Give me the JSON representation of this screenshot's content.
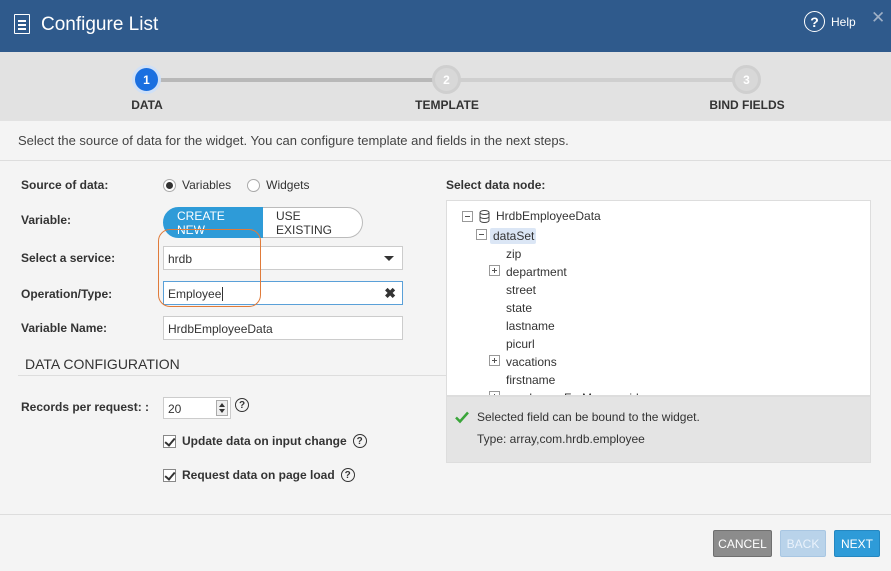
{
  "header": {
    "title": "Configure List",
    "help_label": "Help",
    "close_glyph": "✕"
  },
  "stepper": {
    "steps": [
      {
        "number": "1",
        "label": "DATA",
        "active": true
      },
      {
        "number": "2",
        "label": "TEMPLATE",
        "active": false
      },
      {
        "number": "3",
        "label": "BIND FIELDS",
        "active": false
      }
    ]
  },
  "intro": "Select the source of data for the widget. You can configure template and fields in the next steps.",
  "form": {
    "source_label": "Source of data:",
    "source_options": [
      "Variables",
      "Widgets"
    ],
    "source_selected": "Variables",
    "variable_label": "Variable:",
    "create_new": "CREATE NEW",
    "use_existing": "USE EXISTING",
    "service_label": "Select a service:",
    "service_value": "hrdb",
    "operation_label": "Operation/Type:",
    "operation_value": "Employee",
    "varname_label": "Variable Name:",
    "varname_value": "HrdbEmployeeData"
  },
  "data_config": {
    "title": "DATA CONFIGURATION",
    "records_label": "Records per request: :",
    "records_value": "20",
    "update_label": "Update data on input change",
    "request_label": "Request data on page load"
  },
  "tree": {
    "label": "Select data node:",
    "root": "HrdbEmployeeData",
    "selected": "dataSet",
    "children": [
      "zip",
      "department",
      "street",
      "state",
      "lastname",
      "picurl",
      "vacations",
      "firstname",
      "employeesForManagerid"
    ]
  },
  "status": {
    "message": "Selected field can be bound to the widget.",
    "type": "Type: array,com.hrdb.employee"
  },
  "footer": {
    "cancel": "CANCEL",
    "back": "BACK",
    "next": "NEXT"
  },
  "colors": {
    "header_bg": "#2f5a8c",
    "accent": "#2e9bd8",
    "step_active": "#1a6fe0"
  }
}
